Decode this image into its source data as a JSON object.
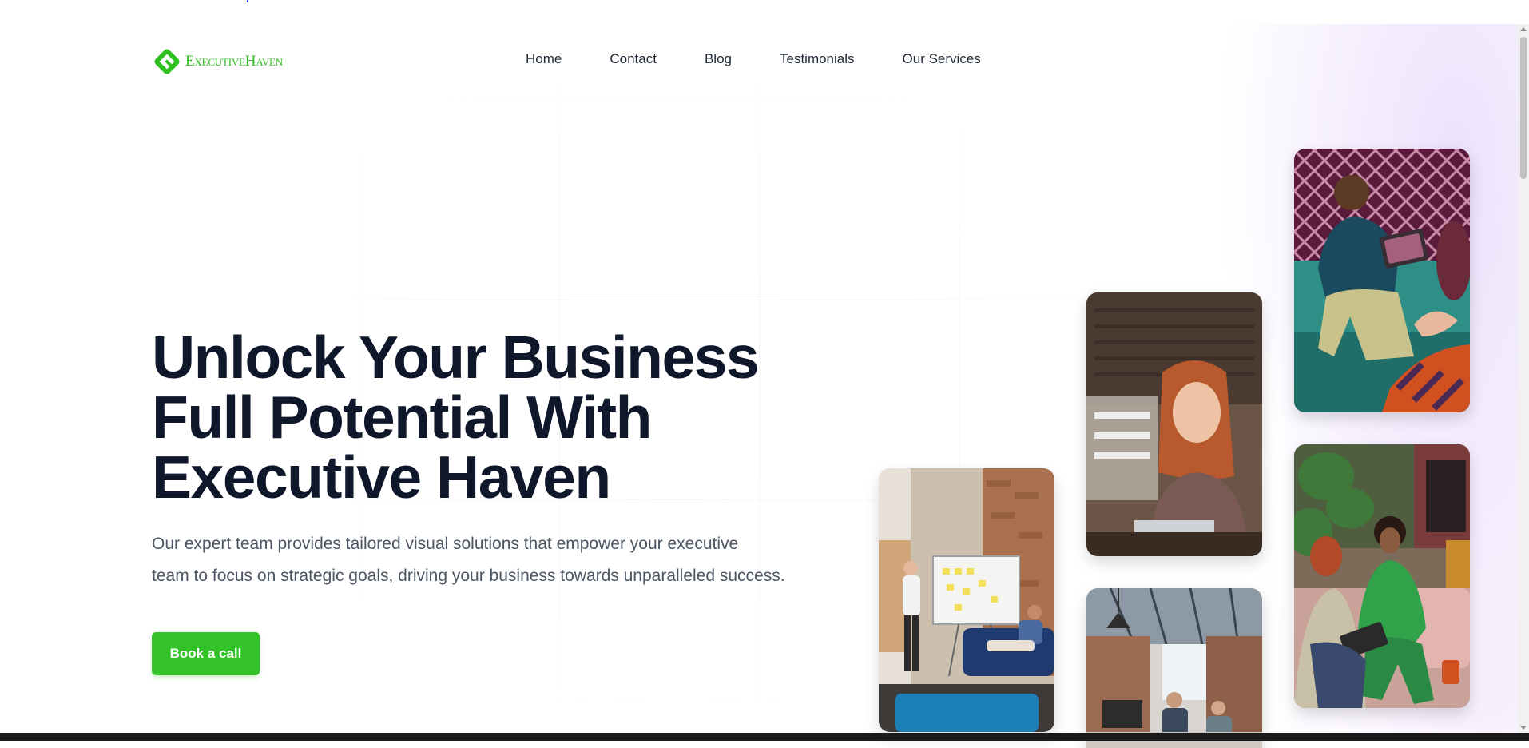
{
  "brand": {
    "name": "ExecutiveHaven",
    "accent_color": "#2ec01e",
    "logo_icon": "brand-logo-icon"
  },
  "nav": {
    "items": [
      {
        "label": "Home"
      },
      {
        "label": "Contact"
      },
      {
        "label": "Blog"
      },
      {
        "label": "Testimonials"
      },
      {
        "label": "Our Services"
      }
    ]
  },
  "hero": {
    "title_line1": "Unlock Your Business",
    "title_line2": "Full Potential With",
    "title_line3": "Executive Haven",
    "subtitle_line1": "Our expert team provides tailored visual solutions that empower your executive",
    "subtitle_line2": "team to focus on strategic goals, driving your business towards unparalleled success.",
    "cta_label": "Book a call",
    "cta_color": "#34c22a"
  },
  "gallery": {
    "photos": [
      {
        "name": "whiteboard-meeting-photo"
      },
      {
        "name": "woman-laptop-photo"
      },
      {
        "name": "coworking-office-photo"
      },
      {
        "name": "man-tablet-photo"
      },
      {
        "name": "women-lounge-photo"
      }
    ]
  }
}
